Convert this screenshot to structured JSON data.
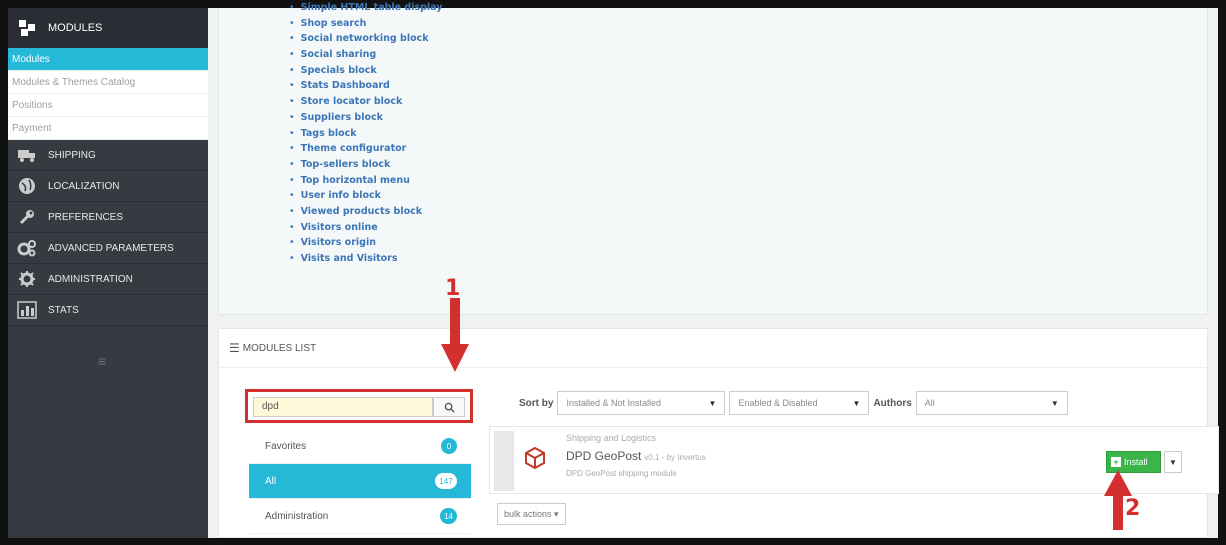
{
  "sidebar": {
    "modules_title": "MODULES",
    "sub_items": [
      {
        "label": "Modules",
        "active": true
      },
      {
        "label": "Modules & Themes Catalog",
        "active": false
      },
      {
        "label": "Positions",
        "active": false
      },
      {
        "label": "Payment",
        "active": false
      }
    ],
    "nav_items": [
      {
        "label": "SHIPPING",
        "icon": "truck-icon"
      },
      {
        "label": "LOCALIZATION",
        "icon": "globe-icon"
      },
      {
        "label": "PREFERENCES",
        "icon": "wrench-icon"
      },
      {
        "label": "ADVANCED PARAMETERS",
        "icon": "cogs-icon"
      },
      {
        "label": "ADMINISTRATION",
        "icon": "gear-icon"
      },
      {
        "label": "STATS",
        "icon": "bar-chart-icon"
      }
    ],
    "collapse_glyph": "≡"
  },
  "module_links": [
    "Simple HTML table display",
    "Shop search",
    "Social networking block",
    "Social sharing",
    "Specials block",
    "Stats Dashboard",
    "Store locator block",
    "Suppliers block",
    "Tags block",
    "Theme configurator",
    "Top-sellers block",
    "Top horizontal menu",
    "User info block",
    "Viewed products block",
    "Visitors online",
    "Visitors origin",
    "Visits and Visitors"
  ],
  "modules_list": {
    "title": "MODULES LIST",
    "search_value": "dpd",
    "categories": [
      {
        "label": "Favorites",
        "count": "0",
        "active": false
      },
      {
        "label": "All",
        "count": "147",
        "active": true
      },
      {
        "label": "Administration",
        "count": "14",
        "active": false
      }
    ],
    "sort_label": "Sort by",
    "sort_install": "Installed & Not Installed",
    "sort_enabled": "Enabled & Disabled",
    "authors_label": "Authors",
    "authors_value": "All",
    "bulk_actions": "bulk actions ▾"
  },
  "module": {
    "category": "Shipping and Logistics",
    "name": "DPD GeoPost",
    "version": "v0.1 - by Invertus",
    "description": "DPD GeoPost shipping module",
    "install_label": "Install"
  },
  "annotations": {
    "step1": "1",
    "step2": "2",
    "color": "#d32f2f"
  }
}
